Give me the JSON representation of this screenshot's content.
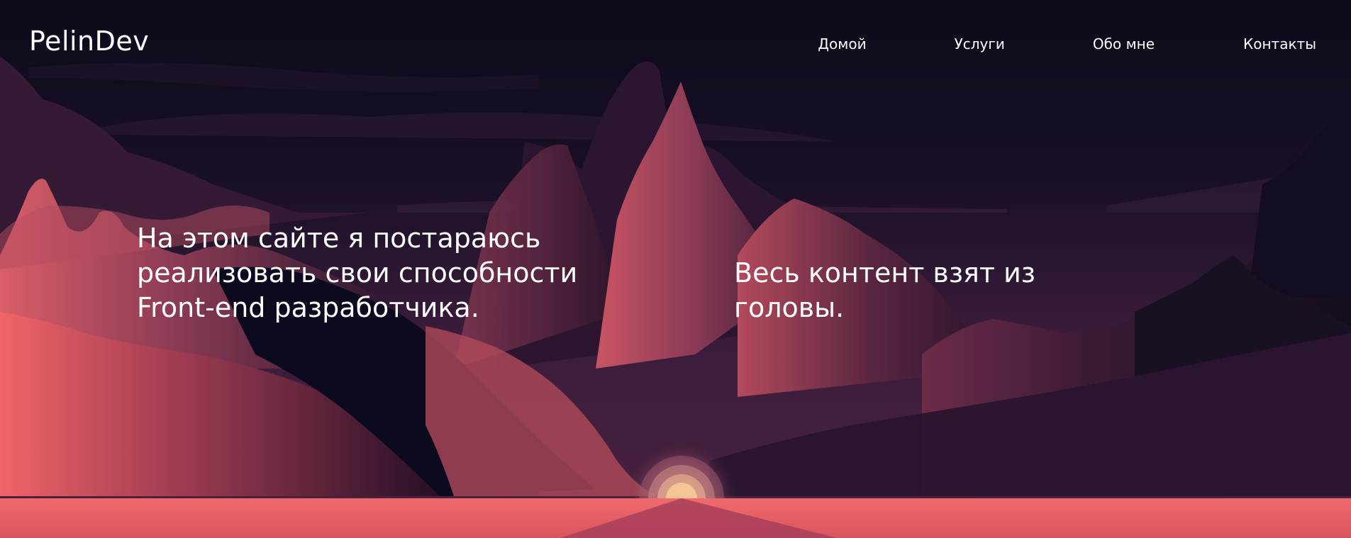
{
  "site": {
    "logo_text": "PelinDev"
  },
  "nav": {
    "items": [
      {
        "label": "Домой"
      },
      {
        "label": "Услуги"
      },
      {
        "label": "Обо мне"
      },
      {
        "label": "Контакты"
      }
    ]
  },
  "hero": {
    "left_lines": [
      "На этом сайте я постараюсь",
      "реализовать свои способности",
      "Front-end разработчика."
    ],
    "right_lines": [
      "Весь контент взят из",
      "головы."
    ]
  },
  "colors": {
    "sky_top": "#0f0b1e",
    "sky_mid": "#2a1630",
    "mountain_pink": "#c9515e",
    "mountain_dark": "#0c0a1e",
    "ground_coral": "#f06468",
    "sun_core": "#f7c792"
  }
}
